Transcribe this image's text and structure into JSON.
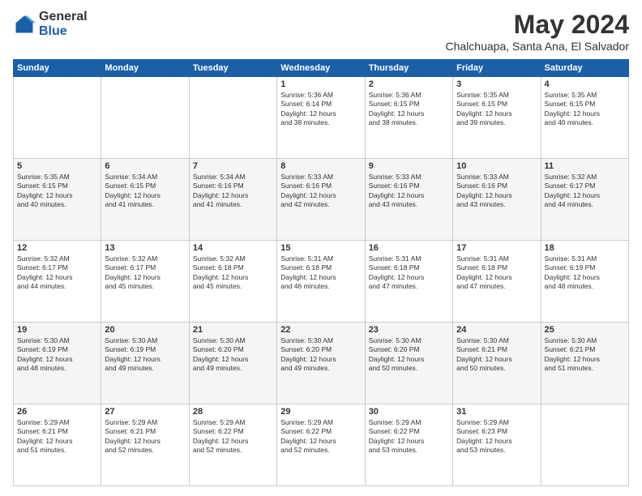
{
  "logo": {
    "general": "General",
    "blue": "Blue"
  },
  "header": {
    "title": "May 2024",
    "subtitle": "Chalchuapa, Santa Ana, El Salvador"
  },
  "weekdays": [
    "Sunday",
    "Monday",
    "Tuesday",
    "Wednesday",
    "Thursday",
    "Friday",
    "Saturday"
  ],
  "weeks": [
    [
      {
        "day": "",
        "info": ""
      },
      {
        "day": "",
        "info": ""
      },
      {
        "day": "",
        "info": ""
      },
      {
        "day": "1",
        "info": "Sunrise: 5:36 AM\nSunset: 6:14 PM\nDaylight: 12 hours\nand 38 minutes."
      },
      {
        "day": "2",
        "info": "Sunrise: 5:36 AM\nSunset: 6:15 PM\nDaylight: 12 hours\nand 38 minutes."
      },
      {
        "day": "3",
        "info": "Sunrise: 5:35 AM\nSunset: 6:15 PM\nDaylight: 12 hours\nand 39 minutes."
      },
      {
        "day": "4",
        "info": "Sunrise: 5:35 AM\nSunset: 6:15 PM\nDaylight: 12 hours\nand 40 minutes."
      }
    ],
    [
      {
        "day": "5",
        "info": "Sunrise: 5:35 AM\nSunset: 6:15 PM\nDaylight: 12 hours\nand 40 minutes."
      },
      {
        "day": "6",
        "info": "Sunrise: 5:34 AM\nSunset: 6:15 PM\nDaylight: 12 hours\nand 41 minutes."
      },
      {
        "day": "7",
        "info": "Sunrise: 5:34 AM\nSunset: 6:16 PM\nDaylight: 12 hours\nand 41 minutes."
      },
      {
        "day": "8",
        "info": "Sunrise: 5:33 AM\nSunset: 6:16 PM\nDaylight: 12 hours\nand 42 minutes."
      },
      {
        "day": "9",
        "info": "Sunrise: 5:33 AM\nSunset: 6:16 PM\nDaylight: 12 hours\nand 43 minutes."
      },
      {
        "day": "10",
        "info": "Sunrise: 5:33 AM\nSunset: 6:16 PM\nDaylight: 12 hours\nand 43 minutes."
      },
      {
        "day": "11",
        "info": "Sunrise: 5:32 AM\nSunset: 6:17 PM\nDaylight: 12 hours\nand 44 minutes."
      }
    ],
    [
      {
        "day": "12",
        "info": "Sunrise: 5:32 AM\nSunset: 6:17 PM\nDaylight: 12 hours\nand 44 minutes."
      },
      {
        "day": "13",
        "info": "Sunrise: 5:32 AM\nSunset: 6:17 PM\nDaylight: 12 hours\nand 45 minutes."
      },
      {
        "day": "14",
        "info": "Sunrise: 5:32 AM\nSunset: 6:18 PM\nDaylight: 12 hours\nand 45 minutes."
      },
      {
        "day": "15",
        "info": "Sunrise: 5:31 AM\nSunset: 6:18 PM\nDaylight: 12 hours\nand 46 minutes."
      },
      {
        "day": "16",
        "info": "Sunrise: 5:31 AM\nSunset: 6:18 PM\nDaylight: 12 hours\nand 47 minutes."
      },
      {
        "day": "17",
        "info": "Sunrise: 5:31 AM\nSunset: 6:18 PM\nDaylight: 12 hours\nand 47 minutes."
      },
      {
        "day": "18",
        "info": "Sunrise: 5:31 AM\nSunset: 6:19 PM\nDaylight: 12 hours\nand 48 minutes."
      }
    ],
    [
      {
        "day": "19",
        "info": "Sunrise: 5:30 AM\nSunset: 6:19 PM\nDaylight: 12 hours\nand 48 minutes."
      },
      {
        "day": "20",
        "info": "Sunrise: 5:30 AM\nSunset: 6:19 PM\nDaylight: 12 hours\nand 49 minutes."
      },
      {
        "day": "21",
        "info": "Sunrise: 5:30 AM\nSunset: 6:20 PM\nDaylight: 12 hours\nand 49 minutes."
      },
      {
        "day": "22",
        "info": "Sunrise: 5:30 AM\nSunset: 6:20 PM\nDaylight: 12 hours\nand 49 minutes."
      },
      {
        "day": "23",
        "info": "Sunrise: 5:30 AM\nSunset: 6:20 PM\nDaylight: 12 hours\nand 50 minutes."
      },
      {
        "day": "24",
        "info": "Sunrise: 5:30 AM\nSunset: 6:21 PM\nDaylight: 12 hours\nand 50 minutes."
      },
      {
        "day": "25",
        "info": "Sunrise: 5:30 AM\nSunset: 6:21 PM\nDaylight: 12 hours\nand 51 minutes."
      }
    ],
    [
      {
        "day": "26",
        "info": "Sunrise: 5:29 AM\nSunset: 6:21 PM\nDaylight: 12 hours\nand 51 minutes."
      },
      {
        "day": "27",
        "info": "Sunrise: 5:29 AM\nSunset: 6:21 PM\nDaylight: 12 hours\nand 52 minutes."
      },
      {
        "day": "28",
        "info": "Sunrise: 5:29 AM\nSunset: 6:22 PM\nDaylight: 12 hours\nand 52 minutes."
      },
      {
        "day": "29",
        "info": "Sunrise: 5:29 AM\nSunset: 6:22 PM\nDaylight: 12 hours\nand 52 minutes."
      },
      {
        "day": "30",
        "info": "Sunrise: 5:29 AM\nSunset: 6:22 PM\nDaylight: 12 hours\nand 53 minutes."
      },
      {
        "day": "31",
        "info": "Sunrise: 5:29 AM\nSunset: 6:23 PM\nDaylight: 12 hours\nand 53 minutes."
      },
      {
        "day": "",
        "info": ""
      }
    ]
  ]
}
